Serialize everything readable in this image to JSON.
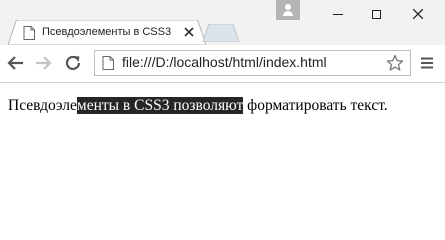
{
  "window": {
    "controls": {
      "minimize": "minimize",
      "maximize": "maximize",
      "close": "close"
    }
  },
  "tab": {
    "title": "Псевдоэлементы в CSS3",
    "favicon": "page-icon",
    "close_icon": "close-icon"
  },
  "toolbar": {
    "back_icon": "arrow-left-icon",
    "forward_icon": "arrow-right-icon",
    "reload_icon": "reload-icon",
    "url": "file:///D:/localhost/html/index.html",
    "bookmark_icon": "star-icon",
    "menu_icon": "hamburger-menu-icon"
  },
  "page": {
    "text_before": "Псевдоэле",
    "text_selected": "менты в CSS3 позволяют",
    "text_after": " форматировать текст."
  },
  "colors": {
    "titlebar": "#f2f2f2",
    "selection_bg": "#262626",
    "selection_text": "#ffffff"
  }
}
